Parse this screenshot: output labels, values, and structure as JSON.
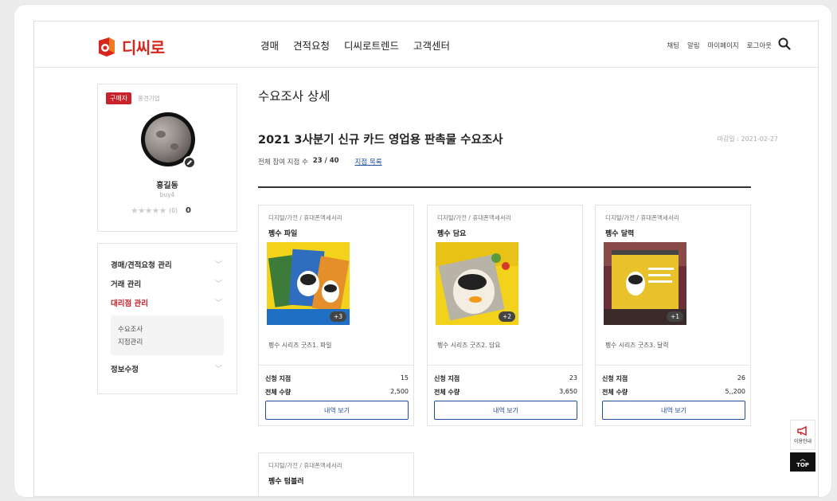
{
  "header": {
    "logo_text": "디씨로",
    "nav": [
      "경매",
      "견적요청",
      "디씨로트렌드",
      "고객센터"
    ],
    "util": [
      "채팅",
      "알림",
      "마이페이지",
      "로그아웃"
    ]
  },
  "profile": {
    "badge": "구매자",
    "company": "홍견기업",
    "name": "홍길동",
    "id": "buy4",
    "stars": "★★★★★",
    "review_count": "(0)",
    "score": "0"
  },
  "side_menu": {
    "items": [
      {
        "label": "경매/견적요청 관리"
      },
      {
        "label": "거래 관리"
      },
      {
        "label": "대리점 관리"
      },
      {
        "label": "정보수정"
      }
    ],
    "sub_items": [
      "수요조사",
      "지점관리"
    ]
  },
  "content": {
    "page_title": "수요조사 상세",
    "survey_title": "2021 3사분기 신규 카드 영업용 판촉물 수요조사",
    "deadline": "마감일 : 2021-02-27",
    "participants_label": "전체 참여 지점 수",
    "participants_value": "23 / 40",
    "branch_link": "지점 목록",
    "cards": [
      {
        "category": "디지털/가전 / 휴대폰액세서리",
        "name": "펭수 파일",
        "more": "+3",
        "desc": "펭수 시리즈 굿즈1. 파일",
        "apply_label": "신청 지점",
        "apply_value": "15",
        "total_label": "전체 수량",
        "total_value": "2,500",
        "button": "내역 보기"
      },
      {
        "category": "디지털/가전 / 휴대폰액세서리",
        "name": "펭수 담요",
        "more": "+2",
        "desc": "펭수 시리즈 굿즈2. 담요",
        "apply_label": "신청 지점",
        "apply_value": "23",
        "total_label": "전체 수량",
        "total_value": "3,650",
        "button": "내역 보기"
      },
      {
        "category": "디지털/가전 / 휴대폰액세서리",
        "name": "펭수 달력",
        "more": "+1",
        "desc": "펭수 시리즈 굿즈3. 달력",
        "apply_label": "신청 지점",
        "apply_value": "26",
        "total_label": "전체 수량",
        "total_value": "5,,200",
        "button": "내역 보기"
      }
    ],
    "card4": {
      "category": "디지털/가전 / 휴대폰액세서리",
      "name": "펭수 텀블러"
    }
  },
  "floating": {
    "notice": "이용안내",
    "top": "TOP"
  },
  "colors": {
    "brand": "#d7261e",
    "link": "#1f4ea1"
  }
}
